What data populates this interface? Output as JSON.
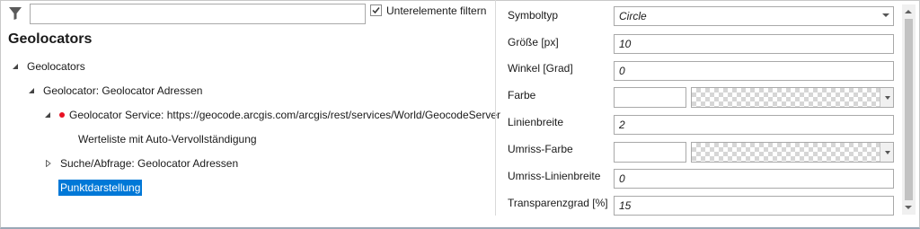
{
  "filter": {
    "icon": "filter-icon",
    "value": "",
    "subelements_checkbox": {
      "label": "Unterelemente filtern",
      "checked": true
    }
  },
  "tree": {
    "title": "Geolocators",
    "nodes": [
      {
        "label": "Geolocators",
        "expanded": true,
        "level": 0
      },
      {
        "label": "Geolocator: Geolocator Adressen",
        "expanded": true,
        "level": 1
      },
      {
        "label": "Geolocator Service: https://geocode.arcgis.com/arcgis/rest/services/World/GeocodeServer",
        "expanded": true,
        "level": 2,
        "status": "error"
      },
      {
        "label": "Werteliste mit Auto-Vervollständigung",
        "level": 3
      },
      {
        "label": "Suche/Abfrage: Geolocator Adressen",
        "expanded": false,
        "level": 2
      },
      {
        "label": "Punktdarstellung",
        "level": 2,
        "selected": true
      }
    ]
  },
  "properties": [
    {
      "label": "Symboltyp",
      "type": "select",
      "value": "Circle"
    },
    {
      "label": "Größe [px]",
      "type": "text",
      "value": "10"
    },
    {
      "label": "Winkel [Grad]",
      "type": "text",
      "value": "0"
    },
    {
      "label": "Farbe",
      "type": "color",
      "value": ""
    },
    {
      "label": "Linienbreite",
      "type": "text",
      "value": "2"
    },
    {
      "label": "Umriss-Farbe",
      "type": "color",
      "value": ""
    },
    {
      "label": "Umriss-Linienbreite",
      "type": "text",
      "value": "0"
    },
    {
      "label": "Transparenzgrad [%]",
      "type": "text",
      "value": "15"
    }
  ],
  "colors": {
    "selection": "#0078d7",
    "error_dot": "#e81123"
  }
}
